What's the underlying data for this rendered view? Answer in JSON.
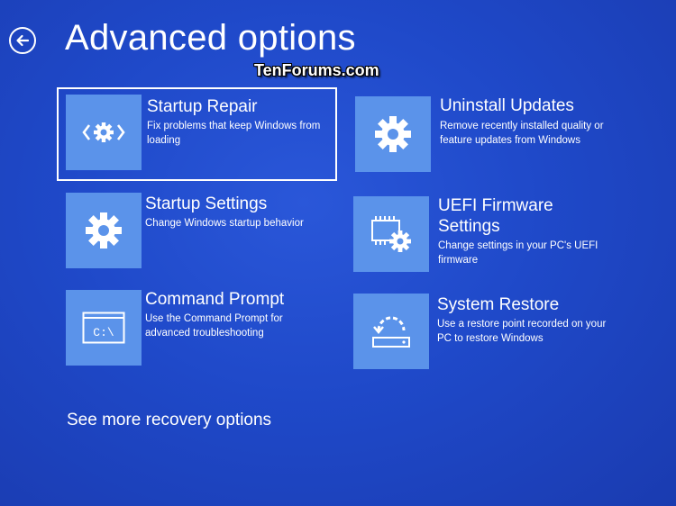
{
  "header": {
    "title": "Advanced options",
    "back_icon": "back-arrow-circle-icon"
  },
  "watermark": "TenForums.com",
  "options": [
    {
      "title": "Startup Repair",
      "desc": "Fix problems that keep Windows from loading",
      "icon": "startup-repair-icon",
      "selected": true
    },
    {
      "title": "Startup Settings",
      "desc": "Change Windows startup behavior",
      "icon": "gear-icon"
    },
    {
      "title": "Command Prompt",
      "desc": "Use the Command Prompt for advanced troubleshooting",
      "icon": "command-prompt-icon",
      "icon_text": "C:\\"
    },
    {
      "title": "Uninstall Updates",
      "desc": "Remove recently installed quality or feature updates from Windows",
      "icon": "gear-icon"
    },
    {
      "title": "UEFI Firmware Settings",
      "desc": "Change settings in your PC's UEFI firmware",
      "icon": "firmware-chip-gear-icon"
    },
    {
      "title": "System Restore",
      "desc": "Use a restore point recorded on your PC to restore Windows",
      "icon": "system-restore-icon"
    }
  ],
  "footer": {
    "more_options": "See more recovery options"
  },
  "colors": {
    "background": "#1f49c9",
    "tile": "#5b93ea",
    "text": "#ffffff"
  }
}
